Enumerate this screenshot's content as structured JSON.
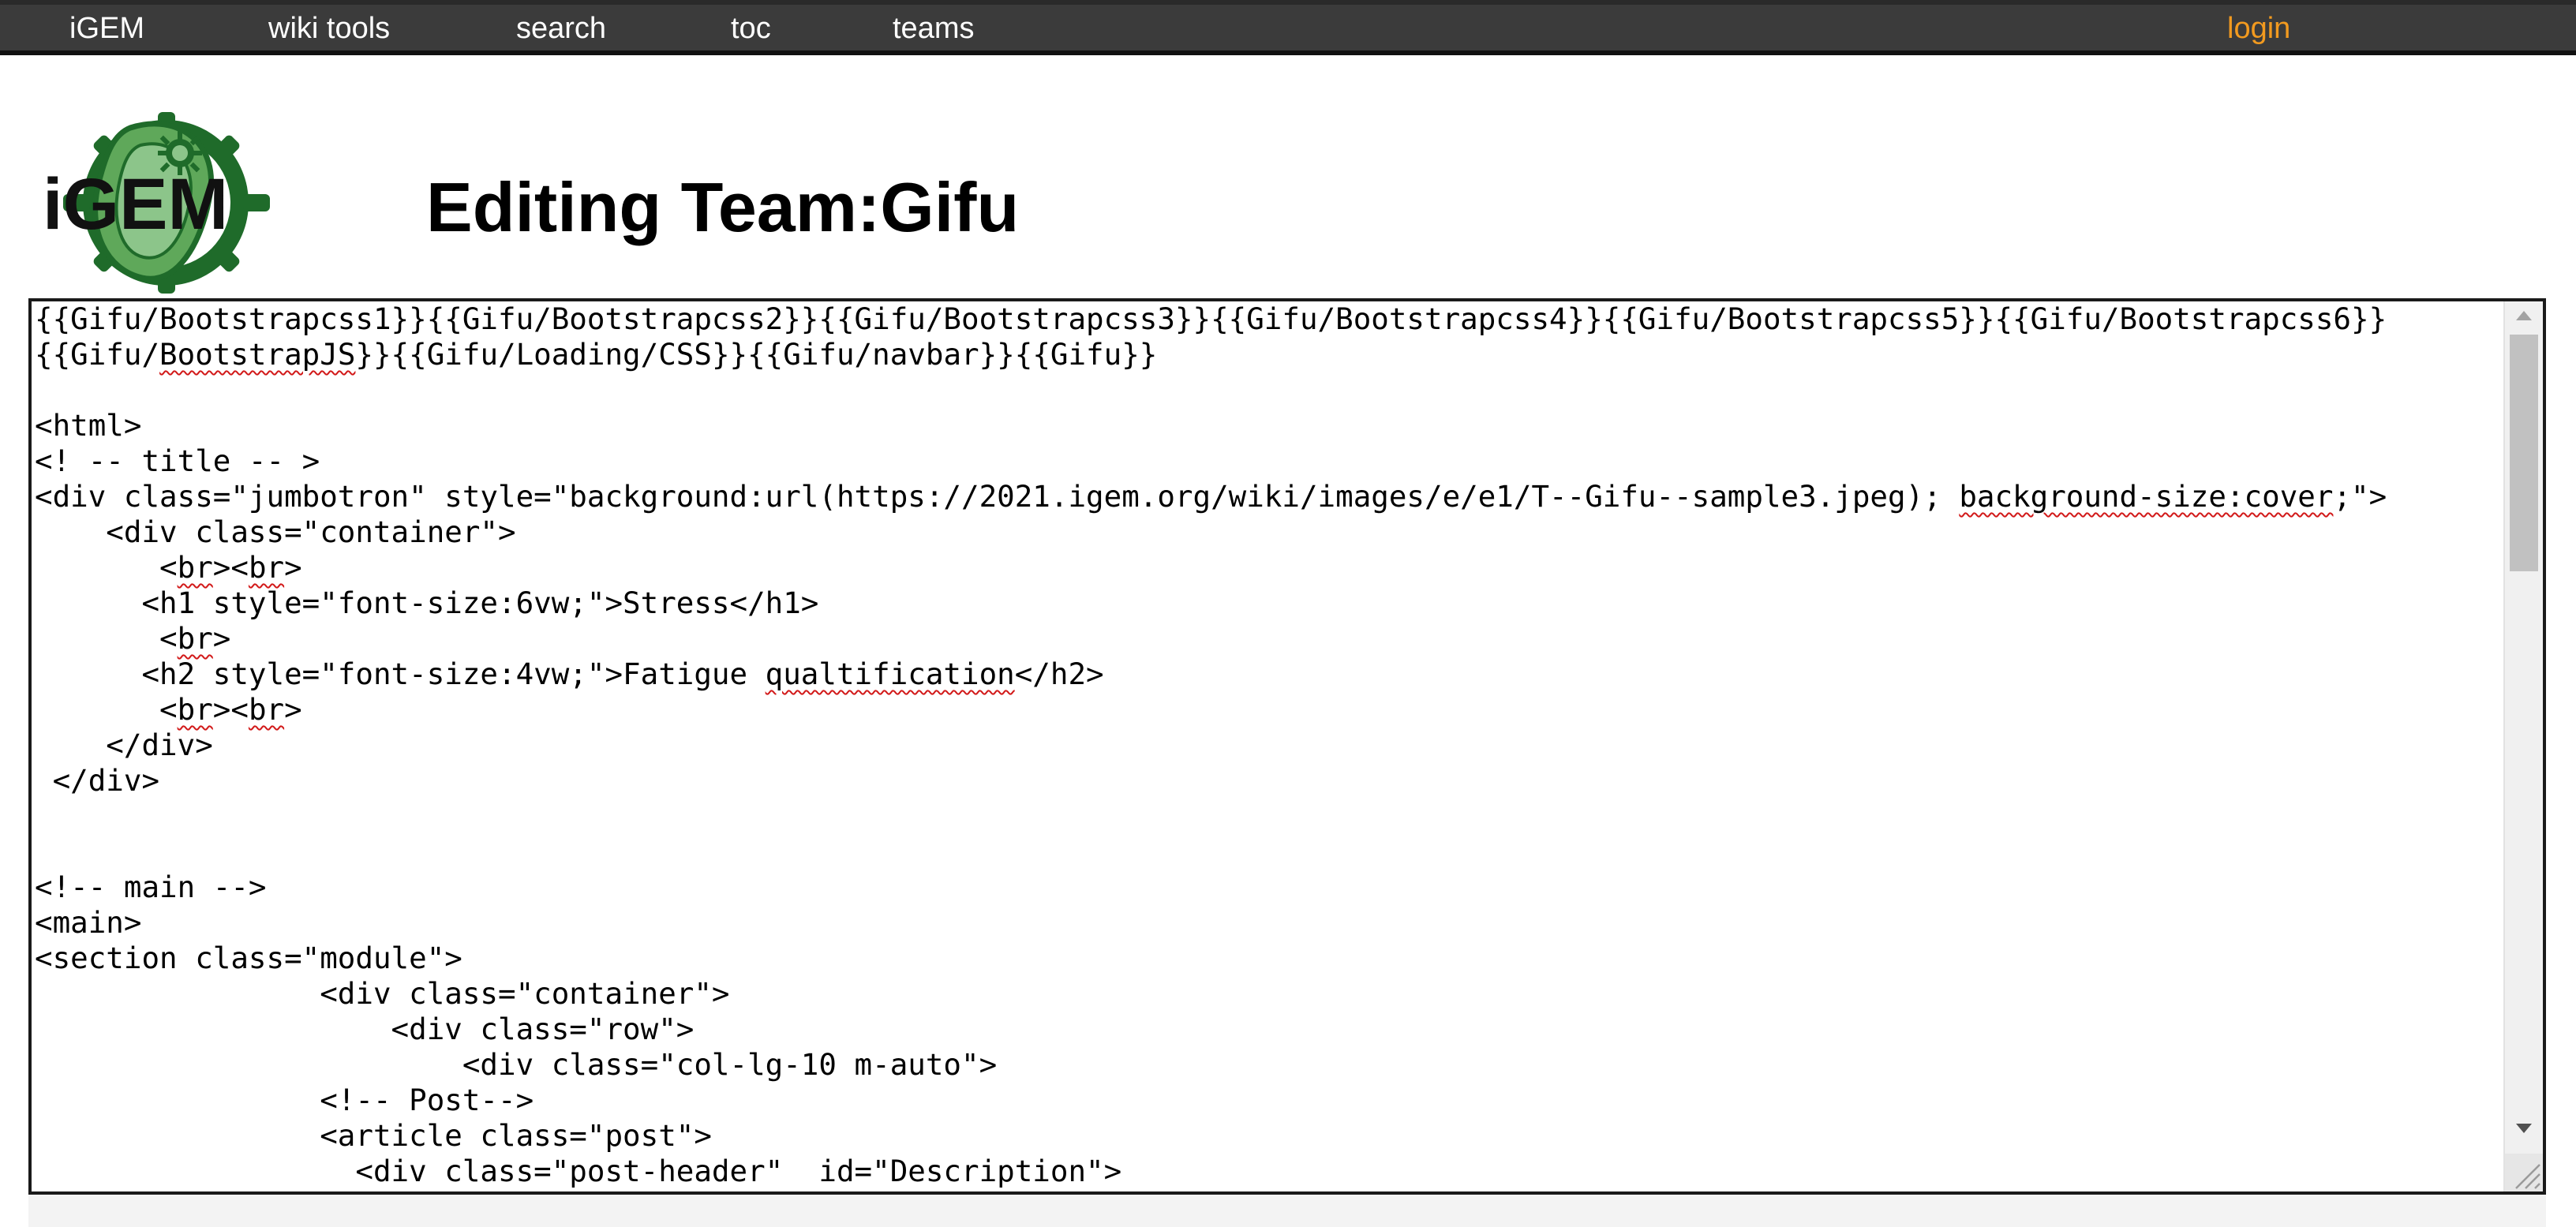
{
  "nav": {
    "items": [
      {
        "label": "iGEM"
      },
      {
        "label": "wiki tools"
      },
      {
        "label": "search"
      },
      {
        "label": "toc"
      },
      {
        "label": "teams"
      }
    ],
    "login_label": "login"
  },
  "logo": {
    "icon": "igem-logo-icon",
    "text": "iGEM"
  },
  "page": {
    "title": "Editing Team:Gifu"
  },
  "editor": {
    "lines": [
      "{{Gifu/Bootstrapcss1}}{{Gifu/Bootstrapcss2}}{{Gifu/Bootstrapcss3}}{{Gifu/Bootstrapcss4}}{{Gifu/Bootstrapcss5}}{{Gifu/Bootstrapcss6}}",
      "{{Gifu/BootstrapJS}}{{Gifu/Loading/CSS}}{{Gifu/navbar}}{{Gifu}}",
      "",
      "<html>",
      "<! -- title -- >",
      "<div class=\"jumbotron\" style=\"background:url(https://2021.igem.org/wiki/images/e/e1/T--Gifu--sample3.jpeg); background-size:cover;\">",
      "    <div class=\"container\">",
      "       <br><br>",
      "      <h1 style=\"font-size:6vw;\">Stress</h1>",
      "       <br>",
      "      <h2 style=\"font-size:4vw;\">Fatigue qualtification</h2>",
      "       <br><br>",
      "    </div>",
      " </div>",
      "",
      "",
      "<!-- main -->",
      "<main>",
      "<section class=\"module\">",
      "                <div class=\"container\">",
      "                    <div class=\"row\">",
      "                        <div class=\"col-lg-10 m-auto\">",
      "                <!-- Post-->",
      "                <article class=\"post\">",
      "                  <div class=\"post-header\"  id=\"Description\">"
    ]
  },
  "colors": {
    "nav_bg": "#3b3b3b",
    "login": "#f29a1f",
    "spellcheck": "#d21919",
    "logo_green": "#5fa85a",
    "logo_dark_green": "#1f6b2a"
  },
  "icons": {
    "scroll_up": "triangle-up-icon",
    "scroll_down": "triangle-down-icon",
    "resize": "resize-grip-icon"
  }
}
